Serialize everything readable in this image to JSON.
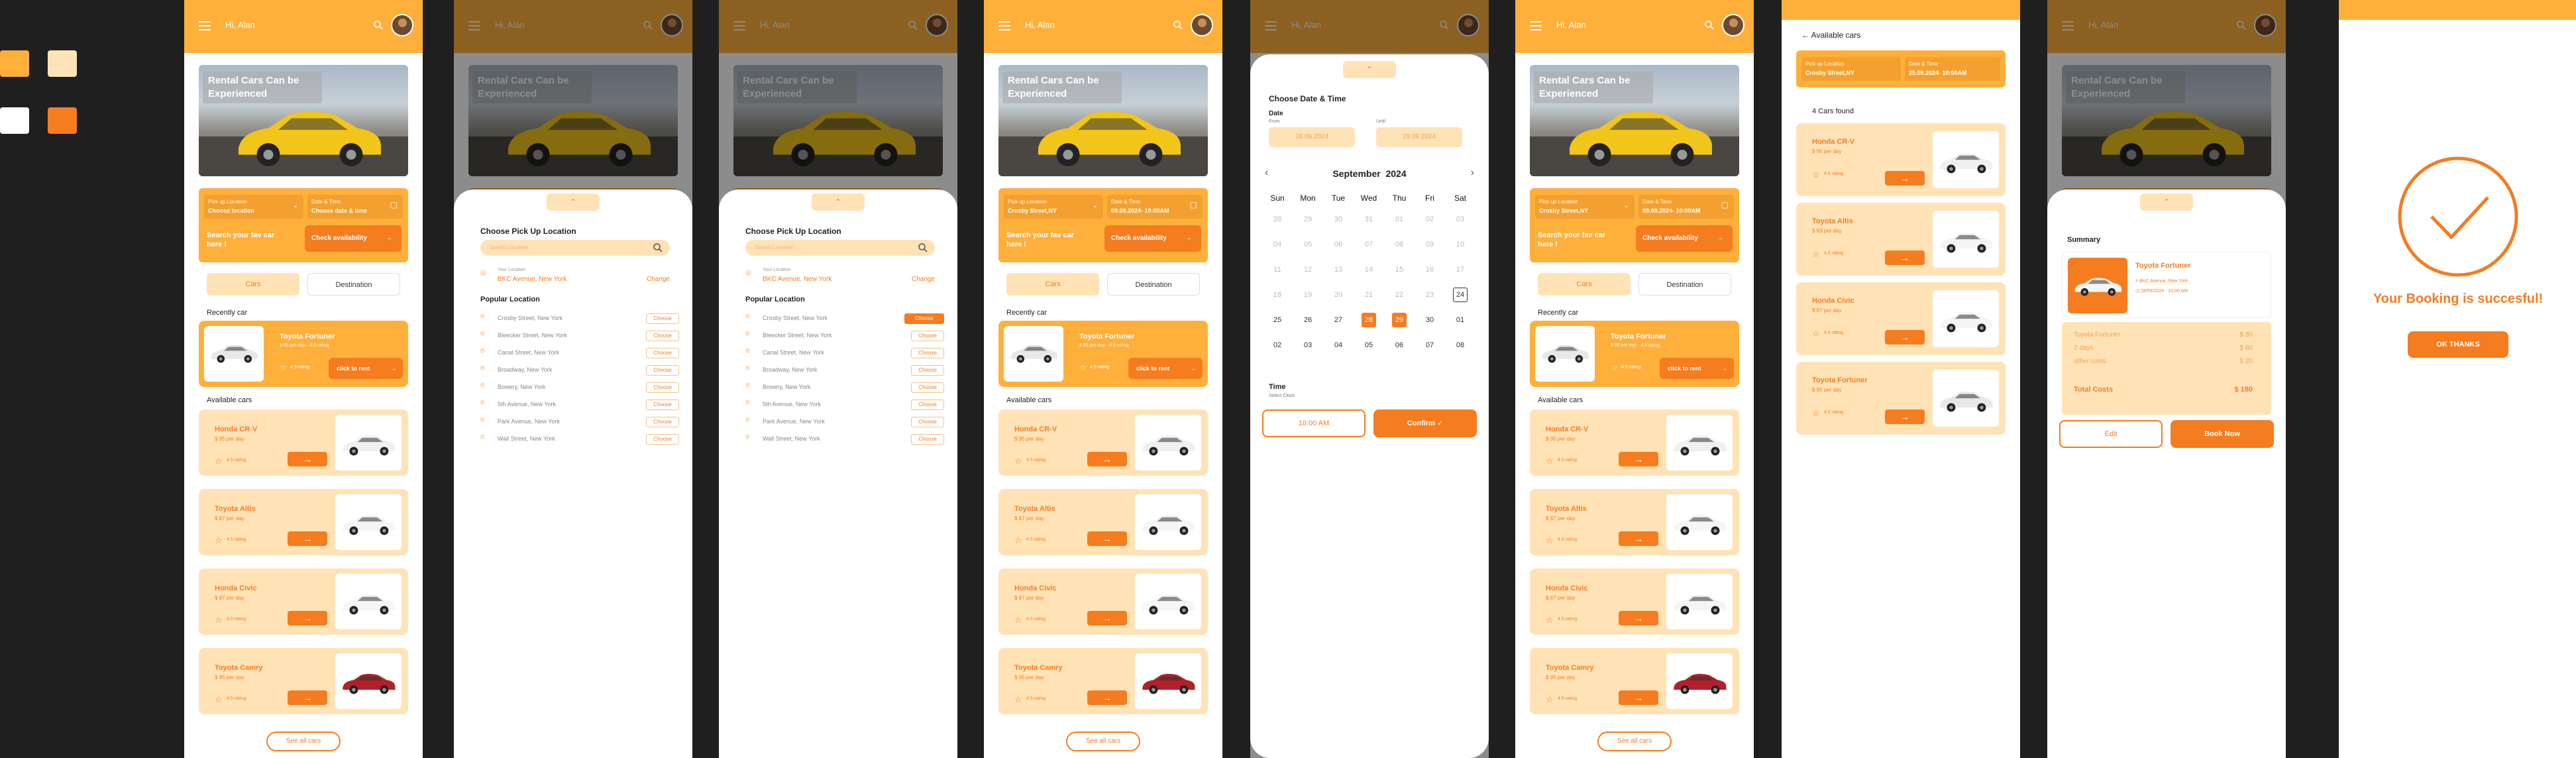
{
  "swatches": [
    {
      "color": "#ffb03b"
    },
    {
      "color": "#ffe3b6"
    },
    {
      "color": "#ffffff"
    },
    {
      "color": "#f57c1f"
    }
  ],
  "colors": {
    "primary": "#f57c1f",
    "accent": "#ffb03b",
    "soft": "#ffe3b6"
  },
  "header": {
    "greeting": "Hi, Alan"
  },
  "hero": {
    "title": "Rental Cars Can be Experienced"
  },
  "search": {
    "pickup_label": "Pick up Location",
    "pickup_value": "Choose location",
    "pickup_value_alt": "Crosby Street,NY",
    "date_label": "Date & Time",
    "date_value": "Choose date & time",
    "date_value_alt": "09.09.2024- 10:00AM",
    "prompt": "Search your fav car here !",
    "check_label": "Check availability"
  },
  "tabs": {
    "cars": "Cars",
    "destination": "Destination"
  },
  "recent": {
    "title": "Recently car",
    "name": "Toyota Fortuner",
    "sub": "$ 95 per day · 4.5 rating",
    "rating": "4.5 rating",
    "action": "click to rent"
  },
  "available": {
    "title": "Available cars",
    "items": [
      {
        "name": "Honda CR-V",
        "price": "$ 95 per day",
        "rating": "4.5 rating"
      },
      {
        "name": "Toyota Altis",
        "price": "$ 87 per day",
        "rating": "4.5 rating"
      },
      {
        "name": "Honda Civic",
        "price": "$ 87 per day",
        "rating": "4.5 rating"
      },
      {
        "name": "Toyota Camry",
        "price": "$ 95 per day",
        "rating": "4.5 rating"
      }
    ],
    "see_all": "See all cars"
  },
  "pickup": {
    "title": "Choose Pick Up Location",
    "search_placeholder": "Search Location",
    "current_label": "Your Location",
    "current": "BKC Avenue, New York",
    "change": "Change",
    "popular_title": "Popular Location",
    "choose": "Choose",
    "chosen": "Choose",
    "locations": [
      "Crosby Street, New York",
      "Bleecker Street, New York",
      "Canal Street, New York",
      "Broadway, New York",
      "Bowery, New York",
      "5th Avenue, New York",
      "Park Avenue, New York",
      "Wall Street, New York"
    ]
  },
  "calendar": {
    "title": "Choose Date & Time",
    "date_label": "Date",
    "from_label": "From",
    "until_label": "Until",
    "from": "28.09.2024",
    "until": "29.09.2024",
    "month": "September",
    "year": "2024",
    "weekdays": [
      "Sun",
      "Mon",
      "Tue",
      "Wed",
      "Thu",
      "Fri",
      "Sat"
    ],
    "weeks": [
      [
        "28",
        "29",
        "30",
        "31",
        "01",
        "02",
        "03"
      ],
      [
        "04",
        "05",
        "06",
        "07",
        "08",
        "09",
        "10"
      ],
      [
        "11",
        "12",
        "13",
        "14",
        "15",
        "16",
        "17"
      ],
      [
        "18",
        "19",
        "20",
        "21",
        "22",
        "23",
        "24"
      ],
      [
        "25",
        "26",
        "27",
        "28",
        "29",
        "30",
        "01"
      ],
      [
        "02",
        "03",
        "04",
        "05",
        "06",
        "07",
        "08"
      ]
    ],
    "time_label": "Time",
    "time_sub": "Select Clock",
    "time_value": "10:00 AM",
    "confirm": "Confirm"
  },
  "results": {
    "back_title": "Available cars",
    "pickup_value": "Crosby Street,NY",
    "date_value": "25.09.2024- 10:00AM",
    "found": "4 Cars found",
    "items": [
      {
        "name": "Honda CR-V",
        "price": "$ 95 per day",
        "rating": "4.5 rating"
      },
      {
        "name": "Toyota Altis",
        "price": "$ 93 per day",
        "rating": "4.5 rating"
      },
      {
        "name": "Honda Civic",
        "price": "$ 87 per day",
        "rating": "4.5 rating"
      },
      {
        "name": "Toyota Fortuner",
        "price": "$ 95 per day",
        "rating": "4.5 rating"
      }
    ]
  },
  "summary": {
    "title": "Summary",
    "car": "Toyota Fortuner",
    "address": "BKC Avenue, New York",
    "datetime": "28/09/2024 - 10:00 AM",
    "lines": [
      {
        "label": "Toyota Fortuner",
        "value": "$ 90"
      },
      {
        "label": "2 days",
        "value": "$ 80"
      },
      {
        "label": "other costs",
        "value": "$ 20"
      }
    ],
    "total_label": "Total Costs",
    "total_value": "$ 180",
    "edit": "Edit",
    "book": "Book Now"
  },
  "success": {
    "message": "Your Booking is succesful!",
    "button": "OK THANKS"
  }
}
